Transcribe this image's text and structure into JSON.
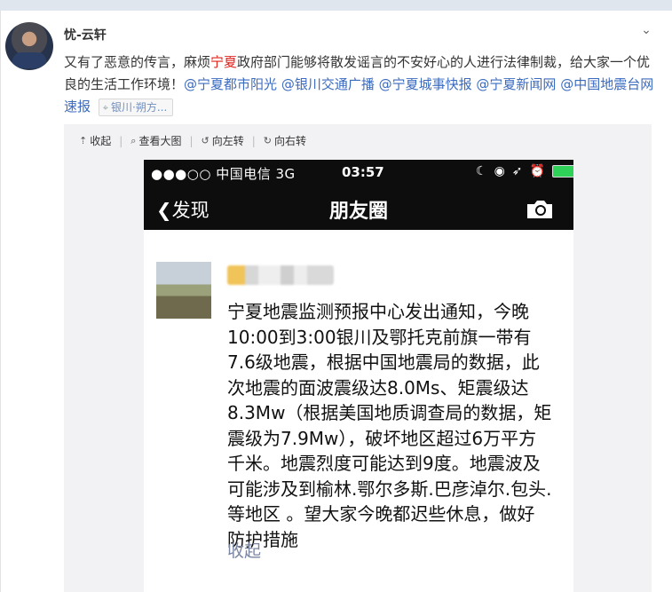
{
  "post": {
    "author": "忧-云轩",
    "text_segments": [
      {
        "text": "又有了恶意的传言，麻烦",
        "type": "text"
      },
      {
        "text": "宁夏",
        "type": "highlight"
      },
      {
        "text": "政府部门能够将散发谣言的不安好心的人进行法律制裁，给大家一个优良的生活工作环境！",
        "type": "text"
      },
      {
        "text": "@宁夏都市阳光",
        "type": "mention"
      },
      {
        "text": " ",
        "type": "text"
      },
      {
        "text": "@银川交通广播",
        "type": "mention"
      },
      {
        "text": " ",
        "type": "text"
      },
      {
        "text": "@宁夏城事快报",
        "type": "mention"
      },
      {
        "text": " ",
        "type": "text"
      },
      {
        "text": "@宁夏新闻网",
        "type": "mention"
      },
      {
        "text": " ",
        "type": "text"
      },
      {
        "text": "@中国地震台网速报",
        "type": "mention"
      }
    ],
    "location": "银川·朔方...",
    "expand_icon": "chevron-down-icon"
  },
  "media_toolbar": {
    "collapse": "收起",
    "view_large": "查看大图",
    "rotate_left": "向左转",
    "rotate_right": "向右转"
  },
  "screenshot": {
    "status": {
      "carrier": "●●●○○ 中国电信  3G",
      "time": "03:57"
    },
    "nav": {
      "back": "发现",
      "title": "朋友圈"
    },
    "moment": {
      "text": "宁夏地震监测预报中心发出通知，今晚10:00到3:00银川及鄂托克前旗一带有7.6级地震，根据中国地震局的数据，此次地震的面波震级达8.0Ms、矩震级达8.3Mw（根据美国地质调查局的数据，矩震级为7.9Mw），破坏地区超过6万平方千米。地震烈度可能达到9度。地震波及可能涉及到榆林.鄂尔多斯.巴彦淖尔.包头.等地区 。望大家今晚都迟些休息，做好防护措施",
      "collapse": "收起"
    }
  },
  "colors": {
    "accent_link": "#3b6bbf",
    "highlight_red": "#e0211b",
    "wechat_dark": "#0d0d0d"
  }
}
